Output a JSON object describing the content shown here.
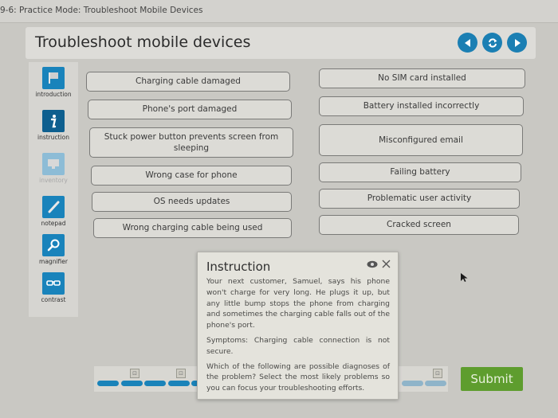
{
  "window": {
    "breadcrumb": "9-6: Practice Mode: Troubleshoot Mobile Devices"
  },
  "header": {
    "title": "Troubleshoot mobile devices",
    "nav": [
      {
        "name": "previous",
        "icon": "chevron-left-icon"
      },
      {
        "name": "reset",
        "icon": "refresh-icon"
      },
      {
        "name": "next",
        "icon": "chevron-right-icon"
      }
    ],
    "accent_color": "#1b7fb3"
  },
  "sidebar": {
    "tools": [
      {
        "label": "introduction",
        "icon": "flag-icon",
        "state": "enabled"
      },
      {
        "label": "instruction",
        "icon": "info-icon",
        "state": "active"
      },
      {
        "label": "inventory",
        "icon": "monitor-icon",
        "state": "disabled"
      },
      {
        "label": "notepad",
        "icon": "pencil-icon",
        "state": "enabled"
      },
      {
        "label": "magnifier",
        "icon": "magnifier-icon",
        "state": "enabled"
      },
      {
        "label": "contrast",
        "icon": "glasses-icon",
        "state": "enabled"
      }
    ]
  },
  "options": {
    "left": [
      "Charging cable damaged",
      "Phone's port damaged",
      "Stuck power button prevents screen from sleeping",
      "Wrong case for phone",
      "OS needs updates",
      "Wrong charging cable being used"
    ],
    "right": [
      "No SIM card installed",
      "Battery installed incorrectly",
      "Misconfigured email",
      "Failing battery",
      "Problematic user activity",
      "Cracked screen"
    ]
  },
  "instruction_popup": {
    "title": "Instruction",
    "paragraphs": [
      "Your next customer, Samuel, says his phone won't charge for very long. He plugs it up, but any little bump stops the phone from charging and sometimes the charging cable falls out of the phone's port.",
      "Symptoms: Charging cable connection is not secure.",
      "Which of the following are possible diagnoses of the problem? Select the most likely problems so you can focus your troubleshooting efforts."
    ]
  },
  "progress": {
    "completed_segments": 5,
    "remaining_segments": 2
  },
  "footer": {
    "submit_label": "Submit",
    "submit_color": "#5e9d2e"
  }
}
